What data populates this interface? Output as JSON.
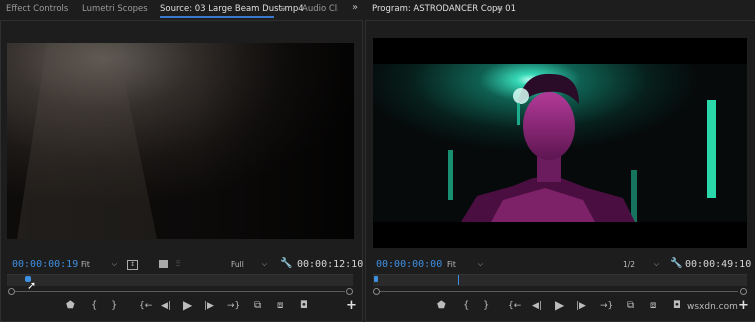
{
  "source_panel": {
    "tabs": [
      {
        "label": "Effect Controls"
      },
      {
        "label": "Lumetri Scopes"
      },
      {
        "label": "Source: 03 Large Beam Dust.mp4"
      },
      {
        "label": "Audio Clip"
      }
    ],
    "menu_glyph": "≡",
    "overflow_glyph": "»",
    "current_time": "00:00:00:19",
    "zoom_select": "Fit",
    "resolution_select": "Full",
    "duration": "00:00:12:10"
  },
  "program_panel": {
    "title": "Program: ASTRODANCER Copy 01",
    "menu_glyph": "≡",
    "current_time": "00:00:00:00",
    "zoom_select": "Fit",
    "resolution_select": "1/2",
    "duration": "00:00:49:10"
  },
  "watermark": "wsxdn.com",
  "colors": {
    "accent_blue": "#3f8fe0",
    "panel_bg": "#1d1d1d",
    "viewer_black": "#000000"
  },
  "icons": {
    "marker": "marker-icon",
    "mark_in": "mark-in-icon",
    "mark_out": "mark-out-icon",
    "go_to_in": "go-to-in-icon",
    "step_back": "step-back-icon",
    "play": "play-icon",
    "step_forward": "step-forward-icon",
    "go_to_out": "go-to-out-icon",
    "insert": "insert-icon",
    "overwrite": "overwrite-icon",
    "export_frame": "camera-icon",
    "add_button": "plus-icon",
    "settings": "wrench-icon"
  }
}
